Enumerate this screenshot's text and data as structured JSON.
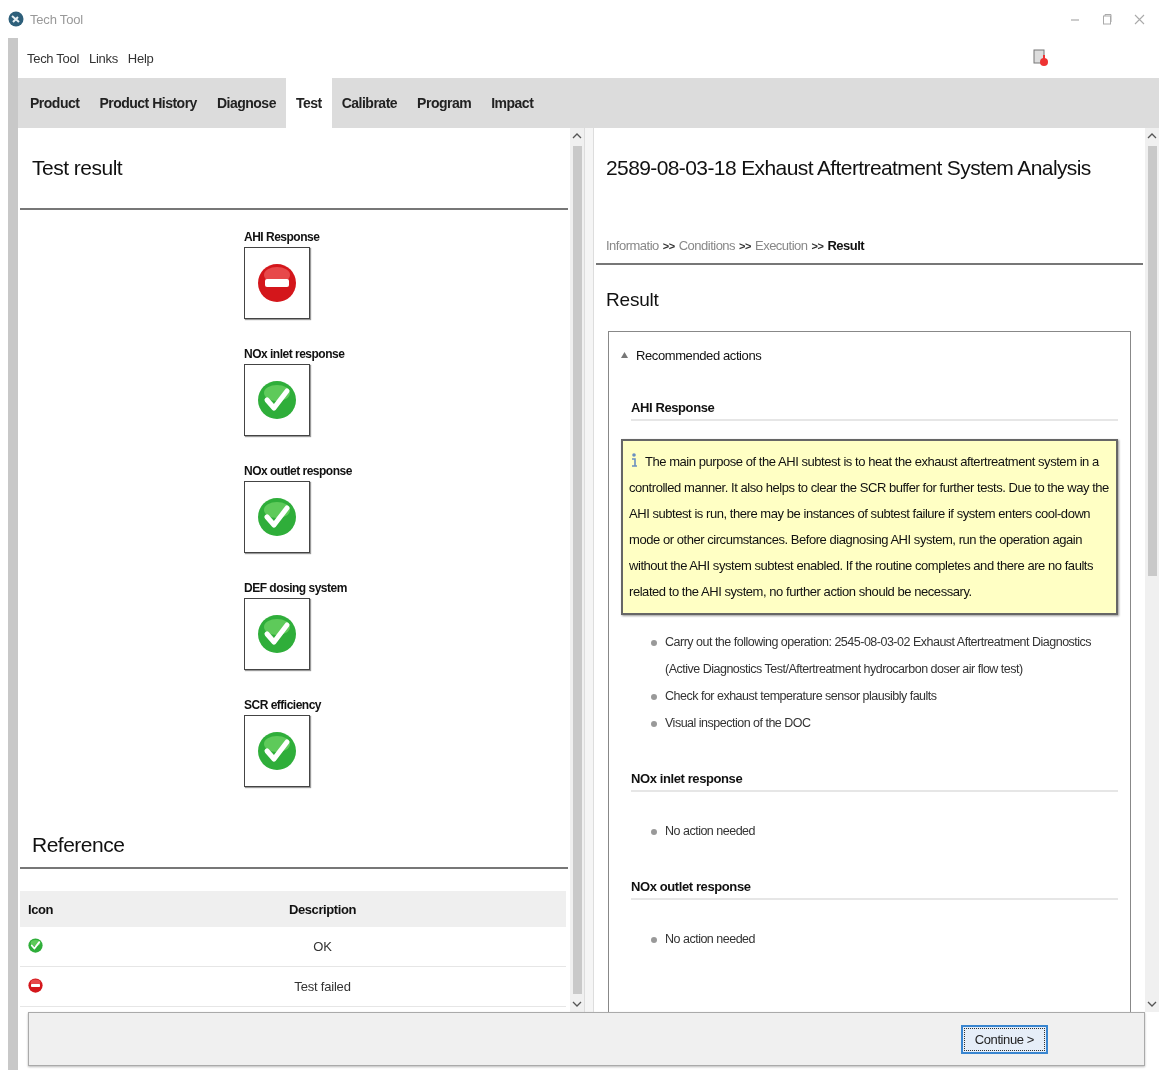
{
  "window": {
    "title": "Tech Tool"
  },
  "menu": [
    "Tech Tool",
    "Links",
    "Help"
  ],
  "tabs": [
    {
      "label": "Product",
      "selected": false
    },
    {
      "label": "Product History",
      "selected": false
    },
    {
      "label": "Diagnose",
      "selected": false
    },
    {
      "label": "Test",
      "selected": true
    },
    {
      "label": "Calibrate",
      "selected": false
    },
    {
      "label": "Program",
      "selected": false
    },
    {
      "label": "Impact",
      "selected": false
    }
  ],
  "test_result": {
    "title": "Test result",
    "tests": [
      {
        "label": "AHI Response",
        "kind": "failed"
      },
      {
        "label": "NOx inlet response",
        "kind": "ok"
      },
      {
        "label": "NOx outlet response",
        "kind": "ok"
      },
      {
        "label": "DEF dosing system",
        "kind": "ok"
      },
      {
        "label": "SCR efficiency",
        "kind": "ok"
      }
    ]
  },
  "reference": {
    "title": "Reference",
    "columns": [
      "Icon",
      "Description"
    ],
    "rows": [
      {
        "kind": "ok",
        "description": "OK"
      },
      {
        "kind": "failed",
        "description": "Test failed"
      }
    ]
  },
  "analysis": {
    "title": "2589-08-03-18 Exhaust Aftertreatment System Analysis",
    "breadcrumb": [
      {
        "label": "Informatio",
        "selected": false
      },
      {
        "separator": ">>",
        "label": "Conditions",
        "selected": false
      },
      {
        "separator": ">>",
        "label": "Execution",
        "selected": false
      },
      {
        "separator": ">>",
        "label": "Result",
        "selected": true
      }
    ],
    "section_title": "Result",
    "recommended": {
      "label": "Recommended actions",
      "expanded": true,
      "groups": [
        {
          "title": "AHI Response",
          "note": "The main purpose of the AHI subtest is to heat the exhaust aftertreatment system in a controlled manner. It also helps to clear the SCR buffer for further tests. Due to the way the AHI subtest is run, there may be instances of subtest failure if system enters cool-down mode or other circumstances. Before diagnosing AHI system, run the operation again without the AHI system subtest enabled. If the routine completes and there are no faults related to the AHI system, no further action should be necessary.",
          "bullets": [
            "Carry out the following operation: 2545-08-03-02 Exhaust Aftertreatment Diagnostics (Active Diagnostics Test/Aftertreatment hydrocarbon doser air flow test)",
            "Check for exhaust temperature sensor plausibly faults",
            "Visual inspection of the DOC"
          ]
        },
        {
          "title": "NOx inlet response",
          "bullets": [
            "No action needed"
          ]
        },
        {
          "title": "NOx outlet response",
          "bullets": [
            "No action needed"
          ]
        }
      ]
    }
  },
  "buttons": [
    "Continue >"
  ]
}
